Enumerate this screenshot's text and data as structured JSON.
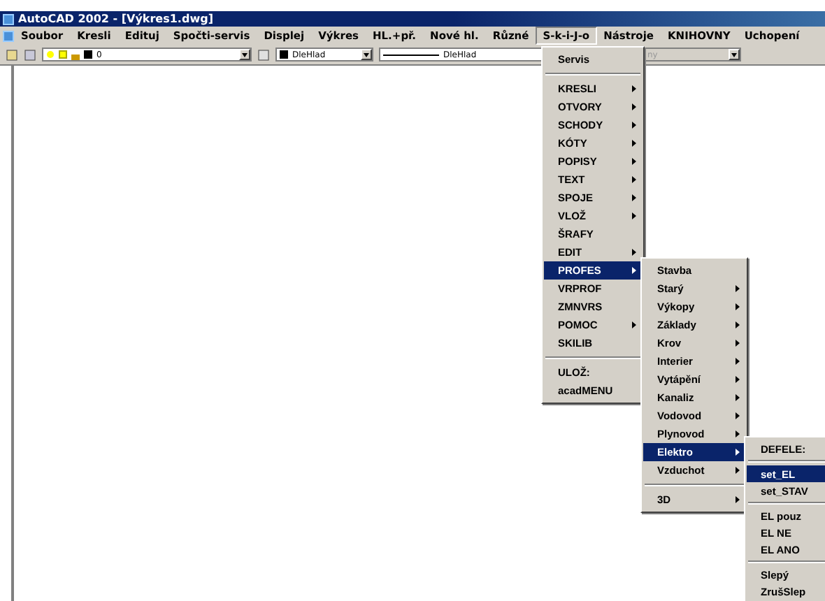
{
  "window": {
    "title": "AutoCAD 2002 - [Výkres1.dwg]"
  },
  "menubar": [
    {
      "label": "Soubor",
      "selected": false
    },
    {
      "label": "Kresli",
      "selected": false
    },
    {
      "label": "Edituj",
      "selected": false
    },
    {
      "label": "Spočti-servis",
      "selected": false
    },
    {
      "label": "Displej",
      "selected": false
    },
    {
      "label": "Výkres",
      "selected": false
    },
    {
      "label": "HL.+př.",
      "selected": false
    },
    {
      "label": "Nové hl.",
      "selected": false
    },
    {
      "label": "Různé",
      "selected": false
    },
    {
      "label": "S-k-i-J-o",
      "selected": true
    },
    {
      "label": "Nástroje",
      "selected": false
    },
    {
      "label": "KNIHOVNY",
      "selected": false
    },
    {
      "label": "Uchopení",
      "selected": false
    }
  ],
  "toolbar": {
    "layer": "0",
    "color_setting": "DleHlad",
    "linetype": "DleHlad",
    "plotstyle": {
      "value": "ny",
      "disabled": true
    }
  },
  "menus": [
    {
      "items": [
        {
          "kind": "item",
          "label": "Servis",
          "submenu": false,
          "selected": false
        },
        {
          "kind": "separator"
        },
        {
          "kind": "item",
          "label": "KRESLI",
          "submenu": true,
          "selected": false
        },
        {
          "kind": "item",
          "label": "OTVORY",
          "submenu": true,
          "selected": false
        },
        {
          "kind": "item",
          "label": "SCHODY",
          "submenu": true,
          "selected": false
        },
        {
          "kind": "item",
          "label": "KÓTY",
          "submenu": true,
          "selected": false
        },
        {
          "kind": "item",
          "label": "POPISY",
          "submenu": true,
          "selected": false
        },
        {
          "kind": "item",
          "label": "TEXT",
          "submenu": true,
          "selected": false
        },
        {
          "kind": "item",
          "label": "SPOJE",
          "submenu": true,
          "selected": false
        },
        {
          "kind": "item",
          "label": "VLOŽ",
          "submenu": true,
          "selected": false
        },
        {
          "kind": "item",
          "label": "ŠRAFY",
          "submenu": false,
          "selected": false
        },
        {
          "kind": "item",
          "label": "EDIT",
          "submenu": true,
          "selected": false
        },
        {
          "kind": "item",
          "label": "PROFES",
          "submenu": true,
          "selected": true
        },
        {
          "kind": "item",
          "label": "VRPROF",
          "submenu": false,
          "selected": false
        },
        {
          "kind": "item",
          "label": "ZMNVRS",
          "submenu": false,
          "selected": false
        },
        {
          "kind": "item",
          "label": "POMOC",
          "submenu": true,
          "selected": false
        },
        {
          "kind": "item",
          "label": "SKILIB",
          "submenu": false,
          "selected": false
        },
        {
          "kind": "separator"
        },
        {
          "kind": "item",
          "label": "ULOŽ:",
          "submenu": false,
          "selected": false
        },
        {
          "kind": "item",
          "label": "acadMENU",
          "submenu": false,
          "selected": false
        }
      ]
    },
    {
      "items": [
        {
          "kind": "item",
          "label": "Stavba",
          "submenu": false,
          "selected": false
        },
        {
          "kind": "item",
          "label": "Starý",
          "submenu": true,
          "selected": false
        },
        {
          "kind": "item",
          "label": "Výkopy",
          "submenu": true,
          "selected": false
        },
        {
          "kind": "item",
          "label": "Základy",
          "submenu": true,
          "selected": false
        },
        {
          "kind": "item",
          "label": "Krov",
          "submenu": true,
          "selected": false
        },
        {
          "kind": "item",
          "label": "Interier",
          "submenu": true,
          "selected": false
        },
        {
          "kind": "item",
          "label": "Vytápění",
          "submenu": true,
          "selected": false
        },
        {
          "kind": "item",
          "label": "Kanaliz",
          "submenu": true,
          "selected": false
        },
        {
          "kind": "item",
          "label": "Vodovod",
          "submenu": true,
          "selected": false
        },
        {
          "kind": "item",
          "label": "Plynovod",
          "submenu": true,
          "selected": false
        },
        {
          "kind": "item",
          "label": "Elektro",
          "submenu": true,
          "selected": true
        },
        {
          "kind": "item",
          "label": "Vzduchot",
          "submenu": true,
          "selected": false
        },
        {
          "kind": "separator"
        },
        {
          "kind": "item",
          "label": "3D",
          "submenu": true,
          "selected": false
        }
      ]
    },
    {
      "items": [
        {
          "kind": "item",
          "label": "DEFELE:",
          "submenu": false,
          "selected": false
        },
        {
          "kind": "separator"
        },
        {
          "kind": "item",
          "label": "set_EL",
          "submenu": false,
          "selected": true
        },
        {
          "kind": "item",
          "label": "set_STAV",
          "submenu": false,
          "selected": false
        },
        {
          "kind": "separator"
        },
        {
          "kind": "item",
          "label": "EL pouz",
          "submenu": false,
          "selected": false
        },
        {
          "kind": "item",
          "label": "EL NE",
          "submenu": false,
          "selected": false
        },
        {
          "kind": "item",
          "label": "EL ANO",
          "submenu": false,
          "selected": false
        },
        {
          "kind": "separator"
        },
        {
          "kind": "item",
          "label": "Slepý",
          "submenu": false,
          "selected": false
        },
        {
          "kind": "item",
          "label": "ZrušSlep",
          "submenu": false,
          "selected": false
        }
      ]
    }
  ]
}
